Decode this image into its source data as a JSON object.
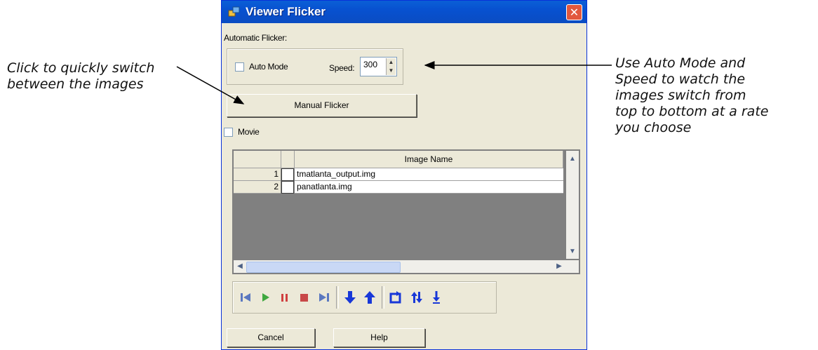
{
  "callouts": {
    "left": [
      "Click to quickly switch",
      "between the images"
    ],
    "right": [
      "Use Auto Mode and",
      "Speed to watch the",
      "images switch from",
      "top to bottom at a rate",
      "you choose"
    ]
  },
  "window": {
    "title": "Viewer Flicker",
    "close_glyph": "✕"
  },
  "automatic": {
    "group_label": "Automatic Flicker:",
    "auto_mode_label": "Auto Mode",
    "auto_mode_checked": false,
    "speed_label": "Speed:",
    "speed_value": "300"
  },
  "manual_flicker_label": "Manual Flicker",
  "movie_label": "Movie",
  "movie_checked": false,
  "table": {
    "column_header": "Image Name",
    "rows": [
      {
        "num": "1",
        "name": "tmatlanta_output.img"
      },
      {
        "num": "2",
        "name": "panatlanta.img"
      }
    ]
  },
  "toolbar": {
    "buttons": [
      "first-frame-icon",
      "play-icon",
      "pause-icon",
      "stop-icon",
      "last-frame-icon",
      "move-down-icon",
      "move-up-icon",
      "loop-icon",
      "swap-order-icon",
      "to-bottom-icon"
    ],
    "colors": {
      "navigation": "#5b78c0",
      "play": "#3fa83f",
      "pause": "#d04040",
      "stop": "#c84848",
      "arrows": "#1838d8"
    }
  },
  "footer": {
    "cancel_label": "Cancel",
    "help_label": "Help"
  }
}
